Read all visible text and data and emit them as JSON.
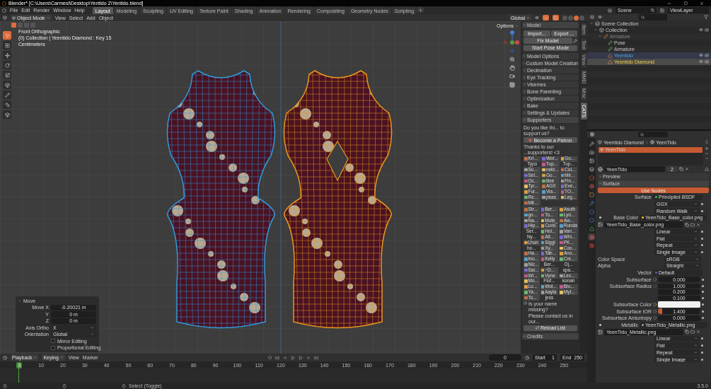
{
  "title": "Blender* [C:\\Users\\Carmesi\\Desktop\\Yentido 2\\Yentido.blend]",
  "menu": [
    "File",
    "Edit",
    "Render",
    "Window",
    "Help"
  ],
  "workspaces": [
    {
      "label": "Layout",
      "selected": true
    },
    {
      "label": "Modeling",
      "selected": false
    },
    {
      "label": "Sculpting",
      "selected": false
    },
    {
      "label": "UV Editing",
      "selected": false
    },
    {
      "label": "Texture Paint",
      "selected": false
    },
    {
      "label": "Shading",
      "selected": false
    },
    {
      "label": "Animation",
      "selected": false
    },
    {
      "label": "Rendering",
      "selected": false
    },
    {
      "label": "Compositing",
      "selected": false
    },
    {
      "label": "Geometry Nodes",
      "selected": false
    },
    {
      "label": "Scripting",
      "selected": false
    }
  ],
  "scene": "Scene",
  "view_layer": "ViewLayer",
  "viewport": {
    "mode": "Object Mode",
    "menus": [
      "View",
      "Select",
      "Add",
      "Object"
    ],
    "orientation": "Global",
    "options": "Options",
    "shading_modes": [
      {
        "selected": false
      },
      {
        "selected": false
      },
      {
        "selected": true
      },
      {
        "selected": false
      }
    ],
    "info": [
      "Front Orthographic",
      "(0) Collection | Yeentido Diamond : Key 15",
      "Centimeters"
    ]
  },
  "move_panel": {
    "title": "Move",
    "fields": [
      {
        "label": "Move X",
        "value": "-0.20021 m"
      },
      {
        "label": "Y",
        "value": "0 m"
      },
      {
        "label": "Z",
        "value": "0 m"
      }
    ],
    "dropdowns": [
      {
        "label": "Axis Ortho",
        "value": "X"
      },
      {
        "label": "Orientation",
        "value": "Global"
      }
    ],
    "options": [
      {
        "label": "Mirror Editing",
        "checked": false
      },
      {
        "label": "Proportional Editing",
        "checked": false
      }
    ]
  },
  "n_panel": {
    "tabs": [
      {
        "label": "Item",
        "selected": false
      },
      {
        "label": "Tool",
        "selected": false
      },
      {
        "label": "View",
        "selected": false
      },
      {
        "label": "MMD",
        "selected": false
      },
      {
        "label": "Misc",
        "selected": false
      },
      {
        "label": "CATS",
        "selected": true
      }
    ],
    "model": {
      "title": "Model",
      "import": "Import...",
      "export": "Export ...",
      "fix": "Fix Model",
      "pose": "Start Pose Mode"
    },
    "sections": [
      {
        "label": "Model Options",
        "expanded": false
      },
      {
        "label": "Custom Model Creation",
        "expanded": false
      },
      {
        "label": "Decimation",
        "expanded": false
      },
      {
        "label": "Eye Tracking",
        "expanded": false
      },
      {
        "label": "Visemes",
        "expanded": false
      },
      {
        "label": "Bone Parenting",
        "expanded": false
      },
      {
        "label": "Optimization",
        "expanded": false
      },
      {
        "label": "Bake",
        "expanded": false
      },
      {
        "label": "Settings & Updates",
        "expanded": false
      }
    ],
    "supporters": {
      "title": "Supporters",
      "question": "Do you like thi... to support us?",
      "patron": "Become a Patron",
      "thanks": "Thanks to our ...supporters! <3",
      "tier_1": [
        {
          "name": "Kri...",
          "avatar": true
        },
        {
          "name": "Wor...",
          "avatar": true
        },
        {
          "name": "Go...",
          "avatar": true
        },
        {
          "name": "Typo",
          "avatar": false
        },
        {
          "name": "Tup...",
          "avatar": true
        },
        {
          "name": "Tup...",
          "avatar": false
        },
        {
          "name": "Su...",
          "avatar": true
        },
        {
          "name": "nekt...",
          "avatar": true
        },
        {
          "name": "Col...",
          "avatar": true
        },
        {
          "name": "Sel...",
          "avatar": true
        },
        {
          "name": "Go...",
          "avatar": true
        },
        {
          "name": "Mir...",
          "avatar": true
        },
        {
          "name": "Oc...",
          "avatar": true
        },
        {
          "name": "Bee",
          "avatar": true
        },
        {
          "name": "Fin...",
          "avatar": true
        },
        {
          "name": "Tyr...",
          "avatar": true
        },
        {
          "name": "AGX",
          "avatar": true
        },
        {
          "name": "Eve...",
          "avatar": true
        },
        {
          "name": "Fur...",
          "avatar": true
        },
        {
          "name": "Via...",
          "avatar": true
        },
        {
          "name": "TO...",
          "avatar": true
        },
        {
          "name": "Re...",
          "avatar": true
        },
        {
          "name": "peas",
          "avatar": true
        },
        {
          "name": "Leg...",
          "avatar": true
        },
        {
          "name": "Mil...",
          "avatar": true
        }
      ],
      "tier_2": [
        {
          "name": "Str...",
          "avatar": true
        },
        {
          "name": "Ber...",
          "avatar": true
        },
        {
          "name": "Asuth",
          "avatar": true
        },
        {
          "name": "go...",
          "avatar": true
        },
        {
          "name": "To...",
          "avatar": true
        },
        {
          "name": "Lyd...",
          "avatar": true
        },
        {
          "name": "Na...",
          "avatar": true
        },
        {
          "name": "Mute_",
          "avatar": true
        },
        {
          "name": "Aw...",
          "avatar": true
        },
        {
          "name": "Hip...",
          "avatar": true
        },
        {
          "name": "Curio",
          "avatar": true
        },
        {
          "name": "Runda",
          "avatar": true
        },
        {
          "name": "Ser...",
          "avatar": false
        },
        {
          "name": "Hol...",
          "avatar": true
        },
        {
          "name": "Van...",
          "avatar": true
        },
        {
          "name": "Ny...",
          "avatar": false
        },
        {
          "name": "Alt...",
          "avatar": true
        },
        {
          "name": "Whi...",
          "avatar": true
        },
        {
          "name": "Lhun",
          "avatar": true
        },
        {
          "name": "Siggi",
          "avatar": true
        },
        {
          "name": "PK...",
          "avatar": true
        },
        {
          "name": "ho...",
          "avatar": false
        },
        {
          "name": "Xy...",
          "avatar": true
        },
        {
          "name": "Coo...",
          "avatar": true
        },
        {
          "name": "Ha...",
          "avatar": true
        },
        {
          "name": "Tab...",
          "avatar": true
        },
        {
          "name": "Ano...",
          "avatar": true
        },
        {
          "name": "Ino...",
          "avatar": true
        },
        {
          "name": "Kelly",
          "avatar": true
        },
        {
          "name": "Cre...",
          "avatar": true
        },
        {
          "name": "Nic...",
          "avatar": true
        },
        {
          "name": "Ber...",
          "avatar": false
        },
        {
          "name": "Oj...",
          "avatar": false
        },
        {
          "name": "Sai...",
          "avatar": true
        },
        {
          "name": "~D...",
          "avatar": true
        },
        {
          "name": "spa...",
          "avatar": false
        },
        {
          "name": "Wi...",
          "avatar": true
        },
        {
          "name": "Vyne",
          "avatar": true
        },
        {
          "name": "Lex...",
          "avatar": true
        },
        {
          "name": "Mo...",
          "avatar": true
        },
        {
          "name": "Fluf...",
          "avatar": false
        },
        {
          "name": "konan",
          "avatar": false
        },
        {
          "name": "Lu...",
          "avatar": true
        },
        {
          "name": "Wol...",
          "avatar": true
        },
        {
          "name": "Blu...",
          "avatar": true
        },
        {
          "name": "Ya...",
          "avatar": true
        },
        {
          "name": "Aayla",
          "avatar": true
        },
        {
          "name": "Myt...",
          "avatar": true
        },
        {
          "name": "To...",
          "avatar": true
        },
        {
          "name": "jess",
          "avatar": false
        }
      ],
      "missing": "Is your name missing?",
      "contact": "Please contact us in our...",
      "reload": "Reload List"
    },
    "credits": {
      "label": "Credits",
      "expanded": true
    }
  },
  "outliner": {
    "tree": [
      {
        "label": "Scene Collection",
        "kind": "scene_collection",
        "selected": false,
        "active": false,
        "dimmed": false,
        "children": [
          {
            "label": "Collection",
            "kind": "collection",
            "selected": false,
            "active": false,
            "dimmed": false,
            "children": [
              {
                "label": "Armature",
                "kind": "armature",
                "selected": false,
                "active": false,
                "dimmed": true,
                "children": [
                  {
                    "label": "Pose",
                    "kind": "pose",
                    "selected": false,
                    "active": false,
                    "dimmed": false
                  },
                  {
                    "label": "Armature",
                    "kind": "armature_data",
                    "selected": false,
                    "active": false,
                    "dimmed": false
                  },
                  {
                    "label": "Yeentido",
                    "kind": "mesh",
                    "selected": true,
                    "active": false,
                    "dimmed": false
                  },
                  {
                    "label": "Yeentido Diamond",
                    "kind": "mesh",
                    "selected": true,
                    "active": true,
                    "dimmed": false
                  }
                ]
              }
            ]
          }
        ]
      }
    ]
  },
  "properties": {
    "object": "Yeentido Diamond",
    "material": "YeenTido",
    "slots": [
      {
        "label": "YeenTido",
        "selected": true
      }
    ],
    "material_name": "YeenTido",
    "users": "2",
    "panels": [
      {
        "label": "Preview",
        "expanded": false
      },
      {
        "label": "Surface",
        "expanded": true
      }
    ],
    "use_nodes": "Use Nodes",
    "rows": [
      {
        "kind": "socket",
        "label": "Surface",
        "value": "Principled BSDF",
        "color": "#39c15a"
      },
      {
        "kind": "dropdown",
        "value": "GGX"
      },
      {
        "kind": "dropdown",
        "value": "Random Walk"
      },
      {
        "kind": "texture",
        "label": "Base Color",
        "value": "YeenTido_Base_color.png",
        "color": "#e8d020"
      },
      {
        "kind": "image",
        "value": "YeenTido_Base_color.png"
      },
      {
        "kind": "dropdown",
        "value": "Linear"
      },
      {
        "kind": "dropdown",
        "value": "Flat"
      },
      {
        "kind": "dropdown",
        "value": "Repeat"
      },
      {
        "kind": "dropdown",
        "value": "Single Image"
      },
      {
        "kind": "wide_dropdown",
        "label": "Color Space",
        "value": "sRGB"
      },
      {
        "kind": "wide_dropdown",
        "label": "Alpha",
        "value": "Straight"
      },
      {
        "kind": "socket",
        "label": "Vector",
        "value": "Default",
        "color": "#6363c7"
      },
      {
        "kind": "number",
        "label": "Subsurface",
        "value": "0.000"
      },
      {
        "kind": "vector",
        "label": "Subsurface Radius",
        "values": [
          "1.000",
          "0.200",
          "0.100"
        ]
      },
      {
        "kind": "color",
        "label": "Subsurface Color",
        "color": "#f2f2f2"
      },
      {
        "kind": "number",
        "label": "Subsurface IOR",
        "value": "1.400",
        "level": 0.1
      },
      {
        "kind": "number",
        "label": "Subsurface Anisotropy",
        "value": "0.000"
      },
      {
        "kind": "texture",
        "label": "Metallic",
        "value": "YeenTido_Metallic.png",
        "color": "#a1a1a1"
      },
      {
        "kind": "image",
        "value": "YeenTido_Metallic.png"
      },
      {
        "kind": "dropdown",
        "value": "Linear"
      },
      {
        "kind": "dropdown",
        "value": "Flat"
      },
      {
        "kind": "dropdown",
        "value": "Repeat"
      },
      {
        "kind": "dropdown",
        "value": "Single Image"
      }
    ]
  },
  "timeline": {
    "menus": [
      "Playback",
      "Keying",
      "View",
      "Marker"
    ],
    "frame": "0",
    "start_label": "Start",
    "start": "1",
    "end_label": "End",
    "end": "250",
    "ruler": [
      {
        "label": "0",
        "current": true
      },
      {
        "label": "10",
        "current": false
      },
      {
        "label": "20",
        "current": false
      },
      {
        "label": "30",
        "current": false
      },
      {
        "label": "40",
        "current": false
      },
      {
        "label": "50",
        "current": false
      },
      {
        "label": "60",
        "current": false
      },
      {
        "label": "70",
        "current": false
      },
      {
        "label": "80",
        "current": false
      },
      {
        "label": "90",
        "current": false
      },
      {
        "label": "100",
        "current": false
      },
      {
        "label": "110",
        "current": false
      },
      {
        "label": "120",
        "current": false
      },
      {
        "label": "130",
        "current": false
      },
      {
        "label": "140",
        "current": false
      },
      {
        "label": "150",
        "current": false
      },
      {
        "label": "160",
        "current": false
      },
      {
        "label": "170",
        "current": false
      },
      {
        "label": "180",
        "current": false
      },
      {
        "label": "190",
        "current": false
      },
      {
        "label": "200",
        "current": false
      },
      {
        "label": "210",
        "current": false
      },
      {
        "label": "220",
        "current": false
      },
      {
        "label": "230",
        "current": false
      },
      {
        "label": "240",
        "current": false
      },
      {
        "label": "250",
        "current": false
      }
    ]
  },
  "status": {
    "hint": "Select (Toggle)",
    "version": "3.5.0"
  }
}
